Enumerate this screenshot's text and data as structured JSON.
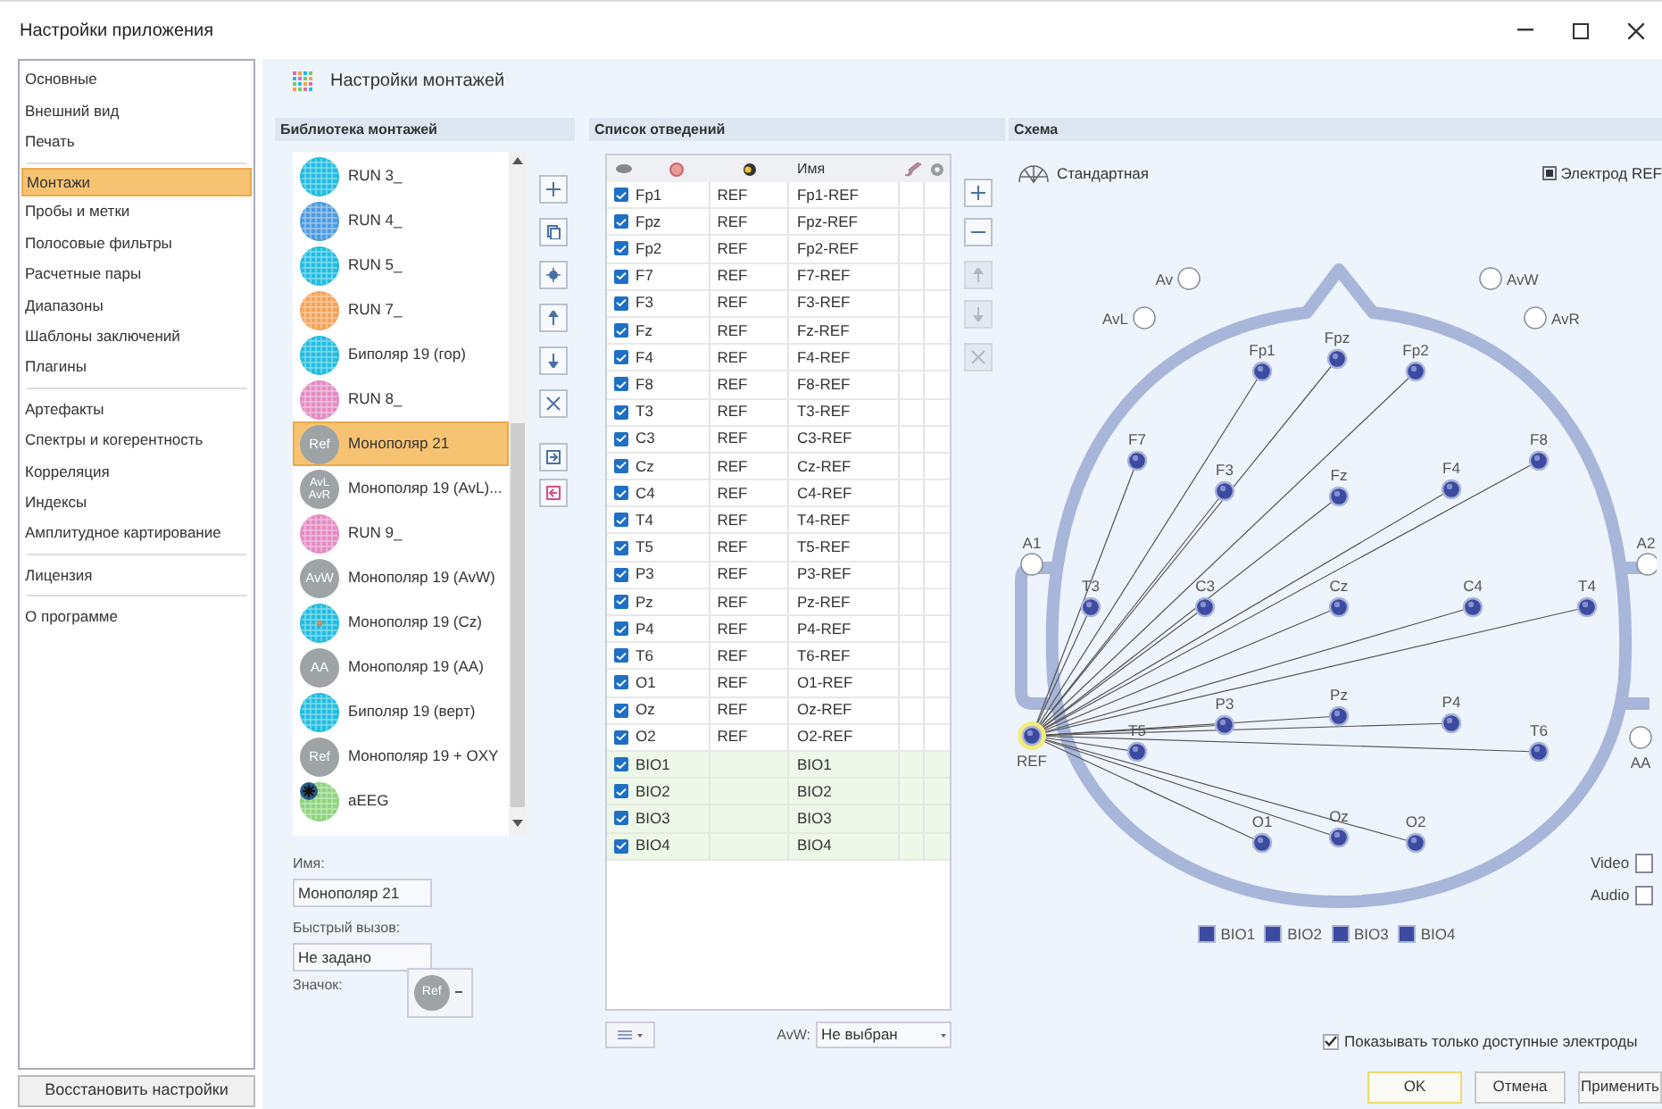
{
  "window": {
    "title": "Настройки приложения"
  },
  "sidebar": {
    "groups": [
      {
        "items": [
          {
            "label": "Основные",
            "selected": false
          },
          {
            "label": "Внешний вид",
            "selected": false
          },
          {
            "label": "Печать",
            "selected": false
          }
        ]
      },
      {
        "items": [
          {
            "label": "Монтажи",
            "selected": true
          },
          {
            "label": "Пробы и метки",
            "selected": false
          },
          {
            "label": "Полосовые фильтры",
            "selected": false
          },
          {
            "label": "Расчетные пары",
            "selected": false
          },
          {
            "label": "Диапазоны",
            "selected": false
          },
          {
            "label": "Шаблоны заключений",
            "selected": false
          },
          {
            "label": "Плагины",
            "selected": false
          }
        ]
      },
      {
        "items": [
          {
            "label": "Артефакты",
            "selected": false
          },
          {
            "label": "Спектры и когерентность",
            "selected": false
          },
          {
            "label": "Корреляция",
            "selected": false
          },
          {
            "label": "Индексы",
            "selected": false
          },
          {
            "label": "Амплитудное картирование",
            "selected": false
          }
        ]
      },
      {
        "items": [
          {
            "label": "Лицензия",
            "selected": false
          }
        ]
      },
      {
        "items": [
          {
            "label": "О программе",
            "selected": false
          }
        ]
      }
    ],
    "restore_button": "Восстановить настройки"
  },
  "page_title": "Настройки монтажей",
  "library": {
    "title": "Библиотека монтажей",
    "items": [
      {
        "name": "RUN 3_",
        "icon": {
          "kind": "grid",
          "color": "#22bde0"
        },
        "selected": false
      },
      {
        "name": "RUN 4_",
        "icon": {
          "kind": "grid",
          "color": "#4f9be0"
        },
        "selected": false
      },
      {
        "name": "RUN 5_",
        "icon": {
          "kind": "grid",
          "color": "#22bde0"
        },
        "selected": false
      },
      {
        "name": "RUN 7_",
        "icon": {
          "kind": "grid",
          "color": "#f4a35a"
        },
        "selected": false
      },
      {
        "name": "Биполяр 19 (гор)",
        "icon": {
          "kind": "grid",
          "color": "#22bde0"
        },
        "selected": false
      },
      {
        "name": "RUN 8_",
        "icon": {
          "kind": "grid",
          "color": "#e48cc4"
        },
        "selected": false
      },
      {
        "name": "Монополяр 21",
        "icon": {
          "kind": "badge",
          "text": "Ref"
        },
        "selected": true
      },
      {
        "name": "Монополяр 19 (AvL)...",
        "icon": {
          "kind": "badge2",
          "text": "AvL",
          "text2": "AvR"
        },
        "selected": false
      },
      {
        "name": "RUN 9_",
        "icon": {
          "kind": "grid",
          "color": "#e48cc4"
        },
        "selected": false
      },
      {
        "name": "Монополяр 19 (AvW)",
        "icon": {
          "kind": "badge",
          "text": "AvW"
        },
        "selected": false
      },
      {
        "name": "Монополяр 19 (Cz)",
        "icon": {
          "kind": "grid-dot",
          "color": "#22bde0"
        },
        "selected": false
      },
      {
        "name": "Монополяр 19 (AA)",
        "icon": {
          "kind": "badge",
          "text": "AA"
        },
        "selected": false
      },
      {
        "name": "Биполяр 19 (верт)",
        "icon": {
          "kind": "grid",
          "color": "#22bde0"
        },
        "selected": false
      },
      {
        "name": "Монополяр 19 + OXY",
        "icon": {
          "kind": "badge",
          "text": "Ref"
        },
        "selected": false
      },
      {
        "name": "aEEG",
        "icon": {
          "kind": "grid-star",
          "color": "#8fd37e"
        },
        "selected": false
      }
    ],
    "tools": [
      {
        "kind": "add",
        "disabled": false
      },
      {
        "kind": "copy",
        "disabled": false
      },
      {
        "kind": "star",
        "disabled": false
      },
      {
        "kind": "up",
        "disabled": false
      },
      {
        "kind": "down",
        "disabled": false
      },
      {
        "kind": "delete",
        "disabled": false
      },
      {
        "kind": "import",
        "disabled": false
      },
      {
        "kind": "export",
        "disabled": false
      }
    ],
    "name_label": "Имя:",
    "name_value": "Монополяр 21",
    "hotkey_label": "Быстрый вызов:",
    "hotkey_value": "Не задано",
    "icon_label": "Значок:",
    "icon_badge": "Ref"
  },
  "table": {
    "title": "Список отведений",
    "name_header": "Имя",
    "rows": [
      {
        "checked": true,
        "electrode": "Fp1",
        "reference": "REF",
        "name": "Fp1-REF",
        "kind": "eeg"
      },
      {
        "checked": true,
        "electrode": "Fpz",
        "reference": "REF",
        "name": "Fpz-REF",
        "kind": "eeg"
      },
      {
        "checked": true,
        "electrode": "Fp2",
        "reference": "REF",
        "name": "Fp2-REF",
        "kind": "eeg"
      },
      {
        "checked": true,
        "electrode": "F7",
        "reference": "REF",
        "name": "F7-REF",
        "kind": "eeg"
      },
      {
        "checked": true,
        "electrode": "F3",
        "reference": "REF",
        "name": "F3-REF",
        "kind": "eeg"
      },
      {
        "checked": true,
        "electrode": "Fz",
        "reference": "REF",
        "name": "Fz-REF",
        "kind": "eeg"
      },
      {
        "checked": true,
        "electrode": "F4",
        "reference": "REF",
        "name": "F4-REF",
        "kind": "eeg"
      },
      {
        "checked": true,
        "electrode": "F8",
        "reference": "REF",
        "name": "F8-REF",
        "kind": "eeg"
      },
      {
        "checked": true,
        "electrode": "T3",
        "reference": "REF",
        "name": "T3-REF",
        "kind": "eeg"
      },
      {
        "checked": true,
        "electrode": "C3",
        "reference": "REF",
        "name": "C3-REF",
        "kind": "eeg"
      },
      {
        "checked": true,
        "electrode": "Cz",
        "reference": "REF",
        "name": "Cz-REF",
        "kind": "eeg"
      },
      {
        "checked": true,
        "electrode": "C4",
        "reference": "REF",
        "name": "C4-REF",
        "kind": "eeg"
      },
      {
        "checked": true,
        "electrode": "T4",
        "reference": "REF",
        "name": "T4-REF",
        "kind": "eeg"
      },
      {
        "checked": true,
        "electrode": "T5",
        "reference": "REF",
        "name": "T5-REF",
        "kind": "eeg"
      },
      {
        "checked": true,
        "electrode": "P3",
        "reference": "REF",
        "name": "P3-REF",
        "kind": "eeg"
      },
      {
        "checked": true,
        "electrode": "Pz",
        "reference": "REF",
        "name": "Pz-REF",
        "kind": "eeg"
      },
      {
        "checked": true,
        "electrode": "P4",
        "reference": "REF",
        "name": "P4-REF",
        "kind": "eeg"
      },
      {
        "checked": true,
        "electrode": "T6",
        "reference": "REF",
        "name": "T6-REF",
        "kind": "eeg"
      },
      {
        "checked": true,
        "electrode": "O1",
        "reference": "REF",
        "name": "O1-REF",
        "kind": "eeg"
      },
      {
        "checked": true,
        "electrode": "Oz",
        "reference": "REF",
        "name": "Oz-REF",
        "kind": "eeg"
      },
      {
        "checked": true,
        "electrode": "O2",
        "reference": "REF",
        "name": "O2-REF",
        "kind": "eeg"
      },
      {
        "checked": true,
        "electrode": "BIO1",
        "name": "BIO1",
        "kind": "bio"
      },
      {
        "checked": true,
        "electrode": "BIO2",
        "name": "BIO2",
        "kind": "bio"
      },
      {
        "checked": true,
        "electrode": "BIO3",
        "name": "BIO3",
        "kind": "bio"
      },
      {
        "checked": true,
        "electrode": "BIO4",
        "name": "BIO4",
        "kind": "bio"
      }
    ],
    "tools": [
      {
        "kind": "add",
        "disabled": false
      },
      {
        "kind": "remove",
        "disabled": false
      },
      {
        "kind": "up",
        "disabled": true
      },
      {
        "kind": "down",
        "disabled": true
      },
      {
        "kind": "delete",
        "disabled": true
      }
    ],
    "avw_label": "AvW:",
    "avw_value": "Не выбран"
  },
  "schema": {
    "title": "Схема",
    "layout_label": "Стандартная",
    "ref_toggle": {
      "label": "Электрод REF",
      "checked": true
    },
    "electrodes": [
      {
        "label": "Fp1",
        "kind": "active"
      },
      {
        "label": "Fpz",
        "kind": "active"
      },
      {
        "label": "Fp2",
        "kind": "active"
      },
      {
        "label": "F7",
        "kind": "active"
      },
      {
        "label": "F3",
        "kind": "active"
      },
      {
        "label": "Fz",
        "kind": "active"
      },
      {
        "label": "F4",
        "kind": "active"
      },
      {
        "label": "F8",
        "kind": "active"
      },
      {
        "label": "A1",
        "kind": "empty"
      },
      {
        "label": "T3",
        "kind": "active"
      },
      {
        "label": "C3",
        "kind": "active"
      },
      {
        "label": "Cz",
        "kind": "active"
      },
      {
        "label": "C4",
        "kind": "active"
      },
      {
        "label": "T4",
        "kind": "active"
      },
      {
        "label": "A2",
        "kind": "empty"
      },
      {
        "label": "T5",
        "kind": "active"
      },
      {
        "label": "P3",
        "kind": "active"
      },
      {
        "label": "Pz",
        "kind": "active"
      },
      {
        "label": "P4",
        "kind": "active"
      },
      {
        "label": "T6",
        "kind": "active"
      },
      {
        "label": "O1",
        "kind": "active"
      },
      {
        "label": "Oz",
        "kind": "active"
      },
      {
        "label": "O2",
        "kind": "active"
      },
      {
        "label": "REF",
        "kind": "ref"
      },
      {
        "label": "Av",
        "kind": "empty"
      },
      {
        "label": "AvL",
        "kind": "empty"
      },
      {
        "label": "AvW",
        "kind": "empty"
      },
      {
        "label": "AvR",
        "kind": "empty"
      },
      {
        "label": "AA",
        "kind": "empty"
      }
    ],
    "video": {
      "label": "Video",
      "checked": false
    },
    "audio": {
      "label": "Audio",
      "checked": false
    },
    "bio": [
      {
        "label": "BIO1",
        "checked": true
      },
      {
        "label": "BIO2",
        "checked": true
      },
      {
        "label": "BIO3",
        "checked": true
      },
      {
        "label": "BIO4",
        "checked": true
      }
    ],
    "only_available": {
      "label": "Показывать только доступные электроды",
      "checked": true
    }
  },
  "buttons": [
    {
      "label": "OK",
      "default": true
    },
    {
      "label": "Отмена",
      "default": false
    },
    {
      "label": "Применить",
      "default": false
    }
  ]
}
